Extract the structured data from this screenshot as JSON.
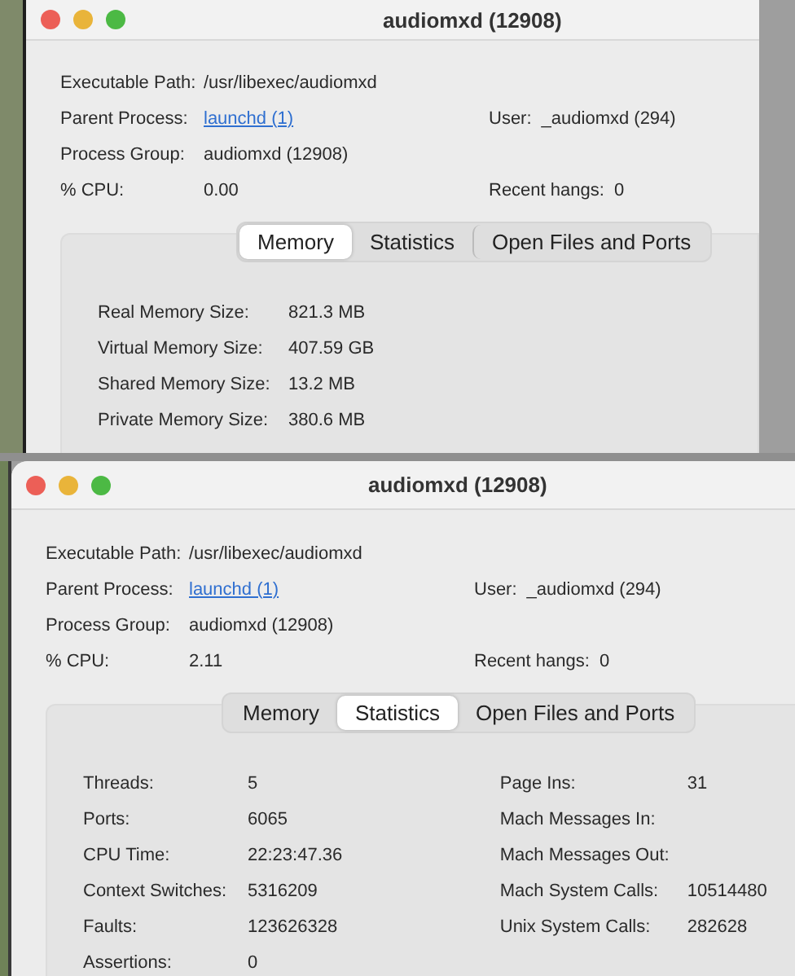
{
  "windows": [
    {
      "title": "audiomxd (12908)",
      "info": [
        {
          "left": {
            "label": "Executable Path:",
            "value": "/usr/libexec/audiomxd",
            "kind": "text"
          }
        },
        {
          "left": {
            "label": "Parent Process:",
            "value": "launchd (1)",
            "kind": "link"
          },
          "right": {
            "label": "User:",
            "value": "_audiomxd (294)"
          }
        },
        {
          "left": {
            "label": "Process Group:",
            "value": "audiomxd (12908)",
            "kind": "text"
          }
        },
        {
          "left": {
            "label": "% CPU:",
            "value": "0.00",
            "kind": "text"
          },
          "right": {
            "label": "Recent hangs:",
            "value": "0"
          }
        }
      ],
      "tabs": [
        {
          "label": "Memory",
          "selected": true
        },
        {
          "label": "Statistics",
          "selected": false
        },
        {
          "label": "Open Files and Ports",
          "selected": false
        }
      ],
      "panel": {
        "kind": "memory",
        "columns": [
          [
            {
              "label": "Real Memory Size:",
              "value": "821.3 MB"
            },
            {
              "label": "Virtual Memory Size:",
              "value": "407.59 GB"
            },
            {
              "label": "Shared Memory Size:",
              "value": "13.2 MB"
            },
            {
              "label": "Private Memory Size:",
              "value": "380.6 MB"
            }
          ]
        ]
      }
    },
    {
      "title": "audiomxd (12908)",
      "info": [
        {
          "left": {
            "label": "Executable Path:",
            "value": "/usr/libexec/audiomxd",
            "kind": "text"
          }
        },
        {
          "left": {
            "label": "Parent Process:",
            "value": "launchd (1)",
            "kind": "link"
          },
          "right": {
            "label": "User:",
            "value": "_audiomxd (294)"
          }
        },
        {
          "left": {
            "label": "Process Group:",
            "value": "audiomxd (12908)",
            "kind": "text"
          }
        },
        {
          "left": {
            "label": "% CPU:",
            "value": "2.11",
            "kind": "text"
          },
          "right": {
            "label": "Recent hangs:",
            "value": "0"
          }
        }
      ],
      "tabs": [
        {
          "label": "Memory",
          "selected": false
        },
        {
          "label": "Statistics",
          "selected": true
        },
        {
          "label": "Open Files and Ports",
          "selected": false
        }
      ],
      "panel": {
        "kind": "statistics",
        "columns": [
          [
            {
              "label": "Threads:",
              "value": "5"
            },
            {
              "label": "Ports:",
              "value": "6065"
            },
            {
              "label": "CPU Time:",
              "value": "22:23:47.36"
            },
            {
              "label": "Context Switches:",
              "value": "5316209"
            },
            {
              "label": "Faults:",
              "value": "123626328"
            },
            {
              "label": "Assertions:",
              "value": "0"
            }
          ],
          [
            {
              "label": "Page Ins:",
              "value": "31"
            },
            {
              "label": "Mach Messages In:"
            },
            {
              "label": "Mach Messages Out:"
            },
            {
              "label": "Mach System Calls:",
              "value": "10514480"
            },
            {
              "label": "Unix System Calls:",
              "value": "282628"
            }
          ]
        ]
      }
    }
  ]
}
